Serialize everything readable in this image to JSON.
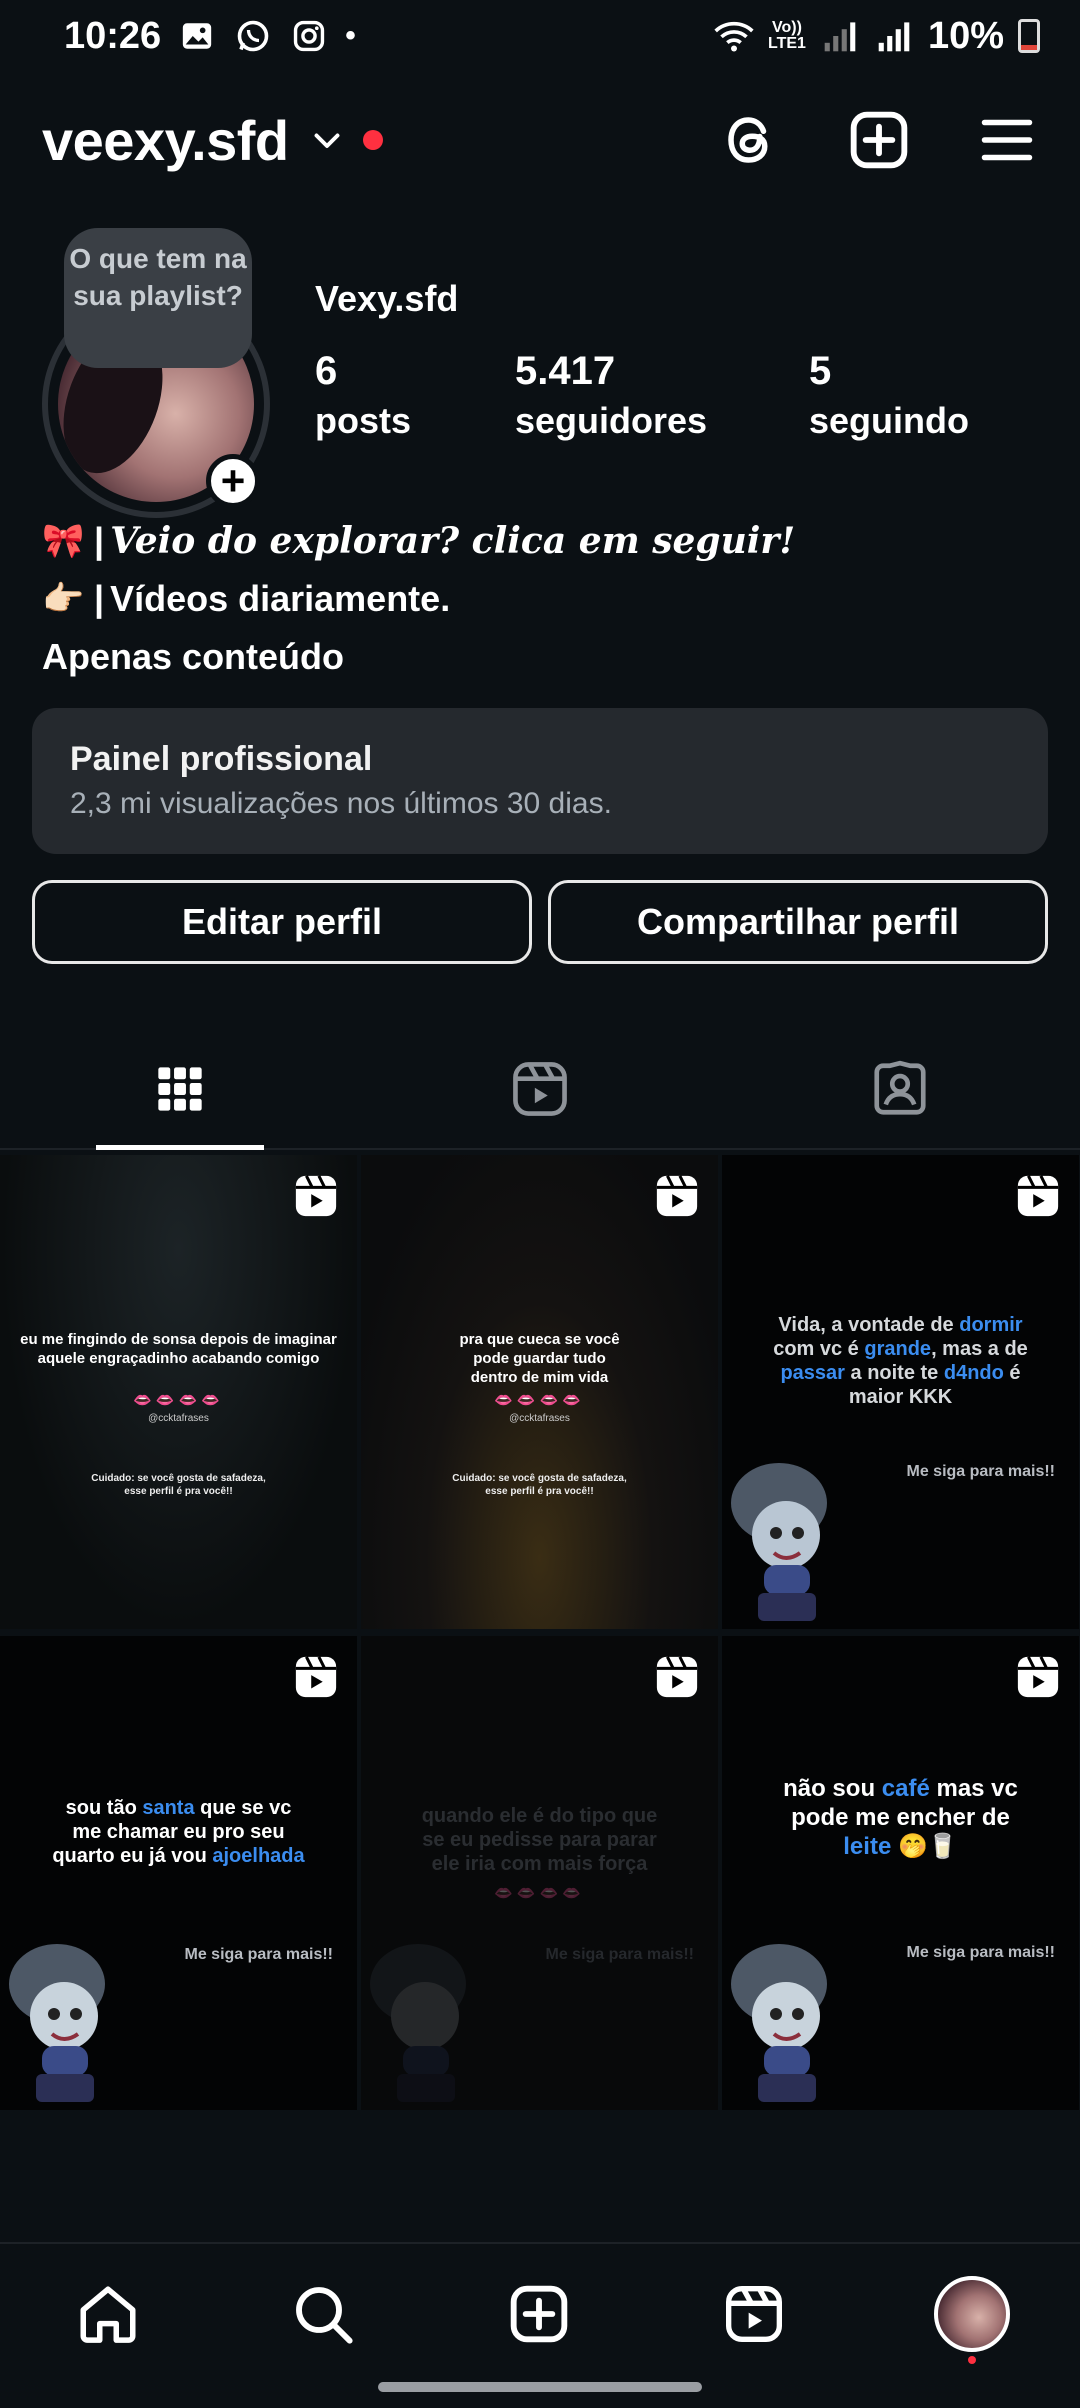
{
  "status_bar": {
    "time": "10:26",
    "dot": "•",
    "lte_top": "Vo))",
    "lte_bottom": "LTE1",
    "battery": "10%"
  },
  "header": {
    "username": "veexy.sfd",
    "icons": [
      "threads-icon",
      "new-post-icon",
      "menu-icon"
    ]
  },
  "profile": {
    "note": "O que tem na sua playlist?",
    "display_name": "Vexy.sfd",
    "stats": [
      {
        "value": "6",
        "label": "posts"
      },
      {
        "value": "5.417",
        "label": "seguidores"
      },
      {
        "value": "5",
        "label": "seguindo"
      }
    ],
    "bio": {
      "line1_emoji": "🎀",
      "line1_text": "Veio do explorar? clica em seguir!",
      "line2_emoji": "👉🏻",
      "line2_text": "Vídeos diariamente.",
      "line3_text": "Apenas conteúdo"
    },
    "add_story": "+"
  },
  "dashboard": {
    "title": "Painel profissional",
    "subtitle": "2,3 mi visualizações nos últimos 30 dias."
  },
  "buttons": {
    "edit": "Editar perfil",
    "share": "Compartilhar perfil"
  },
  "tabs": [
    "grid-icon",
    "reels-icon",
    "tagged-icon"
  ],
  "posts": [
    {
      "caption": "eu me fingindo de sonsa depois de imaginar aquele engraçadinho acabando comigo",
      "hearts": "👄👄👄👄",
      "handle": "@ccktafrases",
      "caution": "Cuidado: se você gosta de safadeza, esse perfil é pra você!!"
    },
    {
      "caption": "pra que cueca se você pode guardar tudo dentro de mim vida",
      "hearts": "👄👄👄👄",
      "handle": "@ccktafrases",
      "caution": "Cuidado: se você gosta de safadeza, esse perfil é pra você!!"
    },
    {
      "caption_a": "Vida, a vontade de ",
      "caption_b": "dormir",
      "caption_c": " com vc é ",
      "caption_d": "grande",
      "caption_e": ", mas a de ",
      "caption_f": "passar",
      "caption_g": " a noite te ",
      "caption_h": "d4ndo",
      "caption_i": " é maior KKK",
      "siga": "Me siga para mais!!"
    },
    {
      "caption_a": "sou tão ",
      "caption_b": "santa",
      "caption_c": " que se vc me chamar eu pro seu quarto eu já vou ",
      "caption_d": "ajoelhada",
      "siga": "Me siga para mais!!"
    },
    {
      "caption": "quando ele é do tipo que se eu pedisse para parar ele iria com mais força",
      "hearts": "👄👄👄👄",
      "siga": "Me siga para mais!!"
    },
    {
      "caption_a": "não sou ",
      "caption_b": "café",
      "caption_c": " mas vc pode me encher de ",
      "caption_d": "leite",
      "caption_e": " 🤭🥛",
      "siga": "Me siga para mais!!"
    }
  ],
  "bottom_nav": [
    "home-icon",
    "search-icon",
    "create-icon",
    "reels-icon",
    "profile-avatar"
  ]
}
